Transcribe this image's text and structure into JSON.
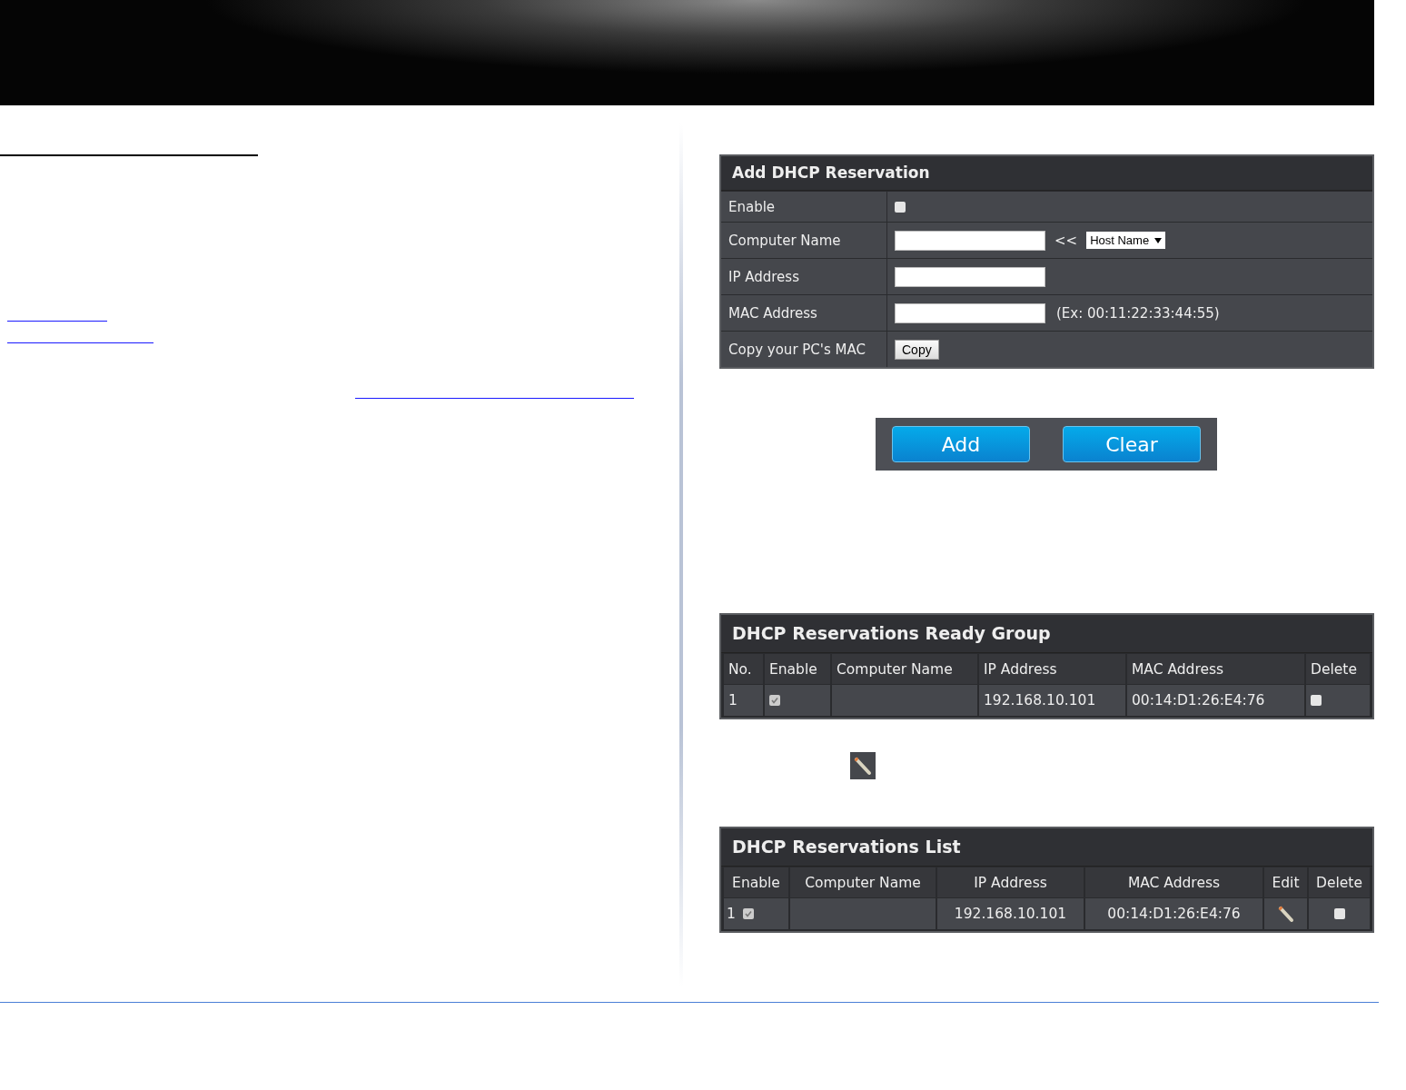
{
  "add_form": {
    "title": "Add DHCP Reservation",
    "rows": [
      {
        "kind": "checkbox",
        "label": "Enable",
        "checked": false
      },
      {
        "kind": "input_select",
        "label": "Computer Name",
        "separator": "<<",
        "select": "Host Name"
      },
      {
        "kind": "input",
        "label": "IP Address"
      },
      {
        "kind": "input_hint",
        "label": "MAC Address",
        "hint": "(Ex: 00:11:22:33:44:55)"
      },
      {
        "kind": "button",
        "label": "Copy your PC's MAC",
        "button": "Copy"
      }
    ]
  },
  "buttons": [
    "Add",
    "Clear"
  ],
  "ready_group": {
    "title": "DHCP Reservations Ready Group",
    "columns": [
      "No.",
      "Enable",
      "Computer Name",
      "IP Address",
      "MAC Address",
      "Delete"
    ],
    "rows": [
      {
        "no": "1",
        "enable": true,
        "ip": "192.168.10.101",
        "mac": "00:14:D1:26:E4:76",
        "delete": false
      }
    ]
  },
  "reservations_list": {
    "title": "DHCP Reservations List",
    "columns": [
      "Enable",
      "Computer Name",
      "IP Address",
      "MAC Address",
      "Edit",
      "Delete"
    ],
    "rows": [
      {
        "no": "1",
        "enable": true,
        "ip": "192.168.10.101",
        "mac": "00:14:D1:26:E4:76",
        "delete": false
      }
    ]
  }
}
